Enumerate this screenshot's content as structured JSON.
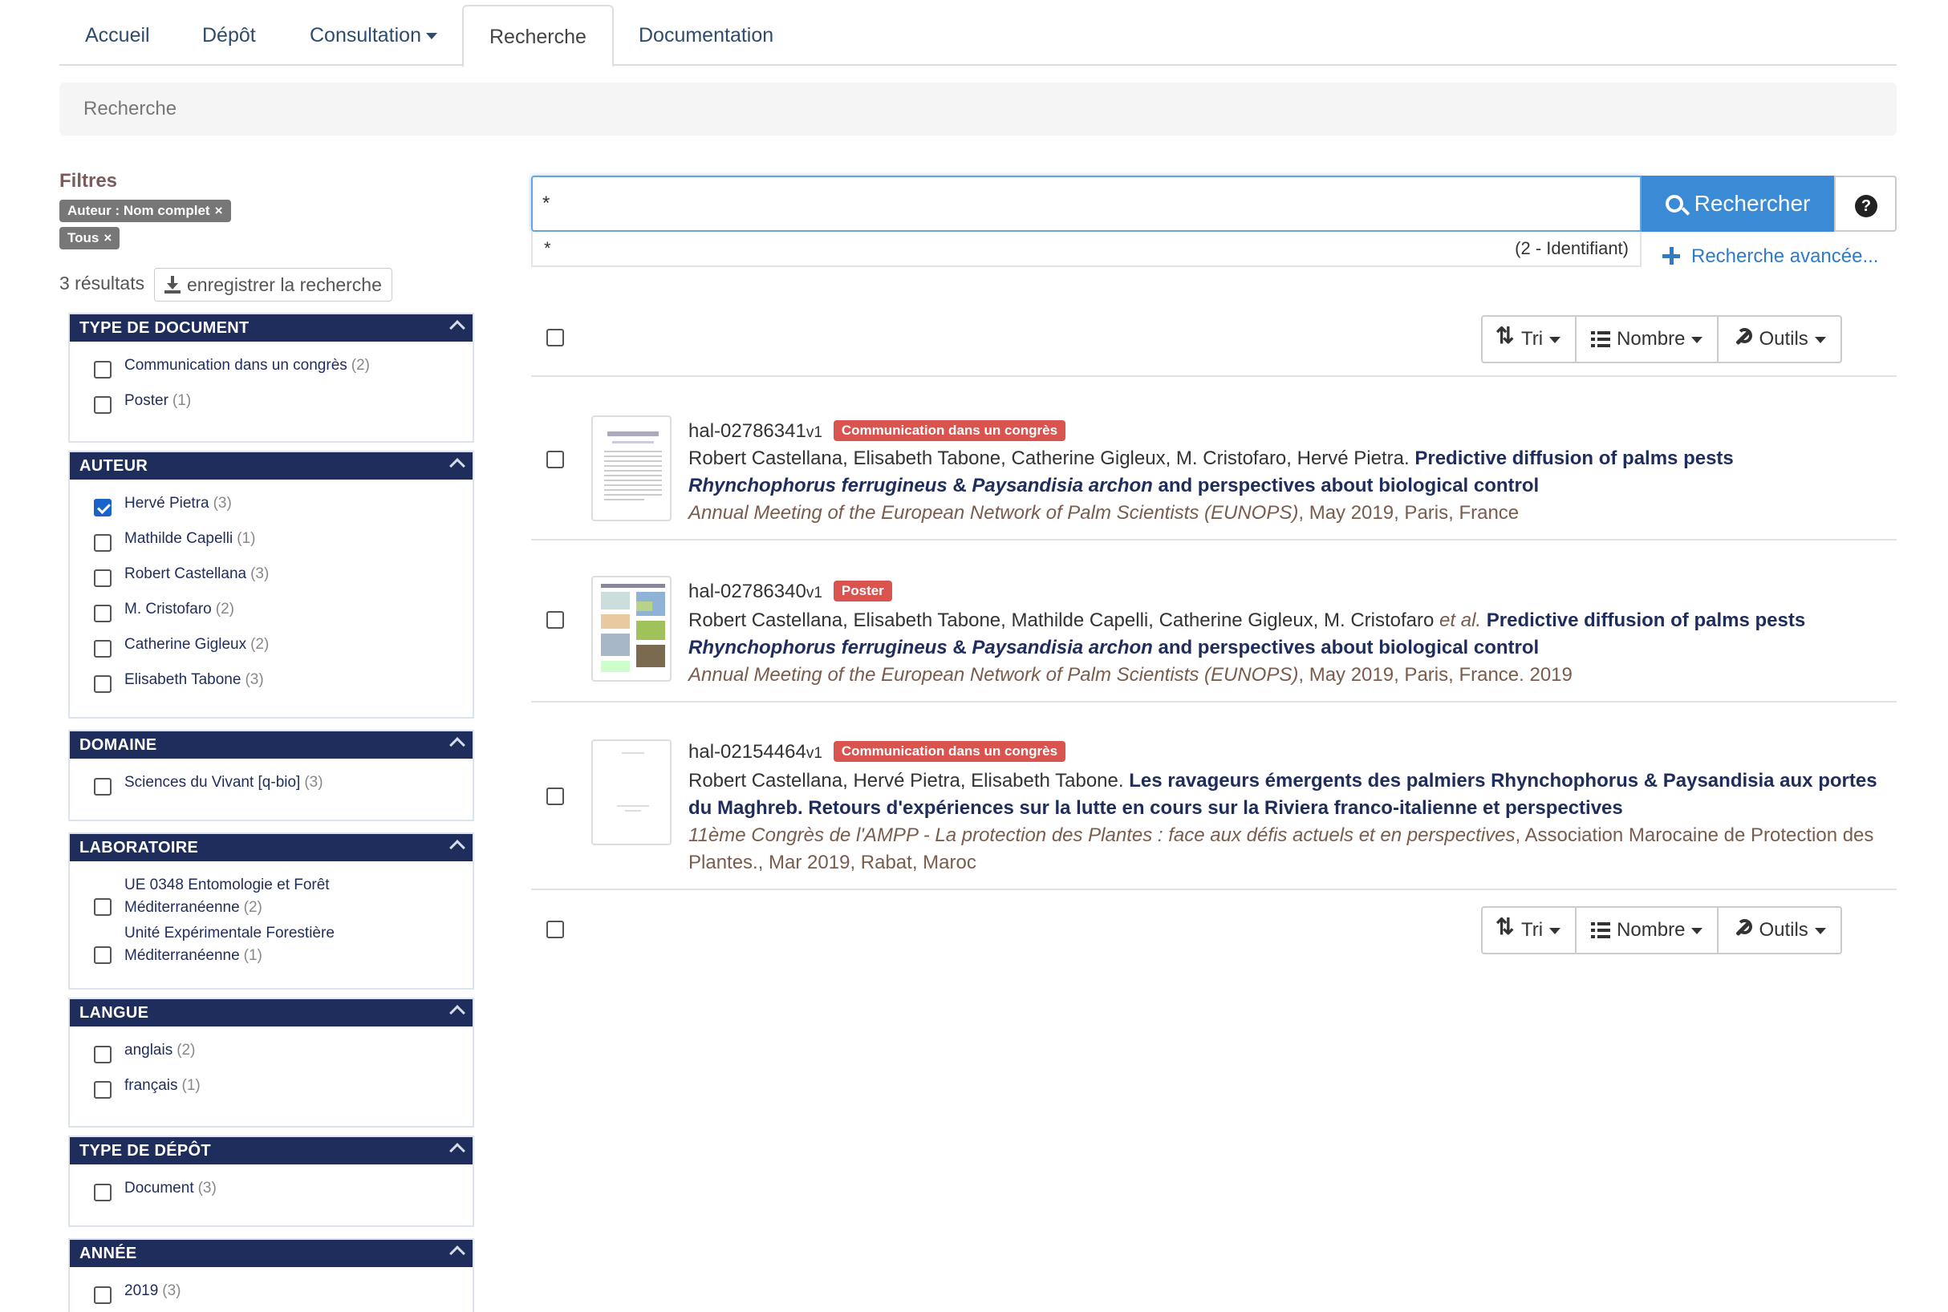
{
  "nav": {
    "tabs": [
      {
        "label": "Accueil"
      },
      {
        "label": "Dépôt"
      },
      {
        "label": "Consultation"
      },
      {
        "label": "Recherche"
      },
      {
        "label": "Documentation"
      }
    ]
  },
  "breadcrumb": "Recherche",
  "filters": {
    "title": "Filtres",
    "tags": [
      "Auteur : Nom complet",
      "Tous"
    ],
    "remove_glyph": "×"
  },
  "results_count": "3 résultats",
  "save_search_label": "enregistrer la recherche",
  "facets": [
    {
      "title": "TYPE DE DOCUMENT",
      "items": [
        {
          "label": "Communication dans un congrès",
          "count": "(2)"
        },
        {
          "label": "Poster",
          "count": "(1)"
        }
      ]
    },
    {
      "title": "AUTEUR",
      "items": [
        {
          "label": "Hervé Pietra",
          "count": "(3)",
          "checked": true
        },
        {
          "label": "Mathilde Capelli",
          "count": "(1)"
        },
        {
          "label": "Robert Castellana",
          "count": "(3)"
        },
        {
          "label": "M. Cristofaro",
          "count": "(2)"
        },
        {
          "label": "Catherine Gigleux",
          "count": "(2)"
        },
        {
          "label": "Elisabeth Tabone",
          "count": "(3)"
        }
      ]
    },
    {
      "title": "DOMAINE",
      "items": [
        {
          "label": "Sciences du Vivant [q-bio]",
          "count": "(3)"
        }
      ]
    },
    {
      "title": "LABORATOIRE",
      "items": [
        {
          "label_line1": "UE 0348 Entomologie et Forêt",
          "label_line2": "Méditerranéenne",
          "count": "(2)"
        },
        {
          "label_line1": "Unité Expérimentale Forestière",
          "label_line2": "Méditerranéenne",
          "count": "(1)"
        }
      ]
    },
    {
      "title": "LANGUE",
      "items": [
        {
          "label": "anglais",
          "count": "(2)"
        },
        {
          "label": "français",
          "count": "(1)"
        }
      ]
    },
    {
      "title": "TYPE DE DÉPÔT",
      "items": [
        {
          "label": "Document",
          "count": "(3)"
        }
      ]
    },
    {
      "title": "ANNÉE",
      "items": [
        {
          "label": "2019",
          "count": "(3)"
        }
      ]
    }
  ],
  "search": {
    "value": "*",
    "button_label": "Rechercher",
    "help_glyph": "?",
    "suggestion_value": "*",
    "suggestion_hint": "(2 - Identifiant)",
    "advanced_label": "Recherche avancée..."
  },
  "toolbar": {
    "sort_label": "Tri",
    "count_label": "Nombre",
    "tools_label": "Outils"
  },
  "results": [
    {
      "id": "hal-02786341",
      "version": "v1",
      "badge": "Communication dans un congrès",
      "authors": "Robert Castellana, Elisabeth Tabone, Catherine Gigleux, M. Cristofaro, Hervé Pietra.",
      "title_part1": "Predictive diffusion of palms pests",
      "title_italic1": "Rhynchophorus ferrugineus",
      "title_amp": " & ",
      "title_italic2": "Paysandisia archon",
      "title_part2": " and perspectives about biological control",
      "venue": "Annual Meeting of the European Network of Palm Scientists (EUNOPS)",
      "tail": ", May 2019, Paris, France"
    },
    {
      "id": "hal-02786340",
      "version": "v1",
      "badge": "Poster",
      "authors": "Robert Castellana, Elisabeth Tabone, Mathilde Capelli, Catherine Gigleux, M. Cristofaro",
      "etal": "et al.",
      "title_part1": "Predictive diffusion of palms pests",
      "title_italic1": "Rhynchophorus ferrugineus",
      "title_amp": " & ",
      "title_italic2": "Paysandisia archon",
      "title_part2": " and perspectives about biological control",
      "venue": "Annual Meeting of the European Network of Palm Scientists (EUNOPS)",
      "tail": ", May 2019, Paris, France. 2019"
    },
    {
      "id": "hal-02154464",
      "version": "v1",
      "badge": "Communication dans un congrès",
      "authors": "Robert Castellana, Hervé Pietra, Elisabeth Tabone.",
      "title_line1": "Les ravageurs émergents des palmiers Rhynchophorus & Paysandisia aux portes",
      "title_line2": "du Maghreb. Retours d'expériences sur la lutte en cours sur la Riviera franco-italienne et perspectives",
      "venue": "11ème Congrès de l'AMPP - La protection des Plantes : face aux défis actuels et en perspectives",
      "tail1": ", Association Marocaine de Protection des",
      "tail2": "Plantes., Mar 2019, Rabat, Maroc"
    }
  ]
}
